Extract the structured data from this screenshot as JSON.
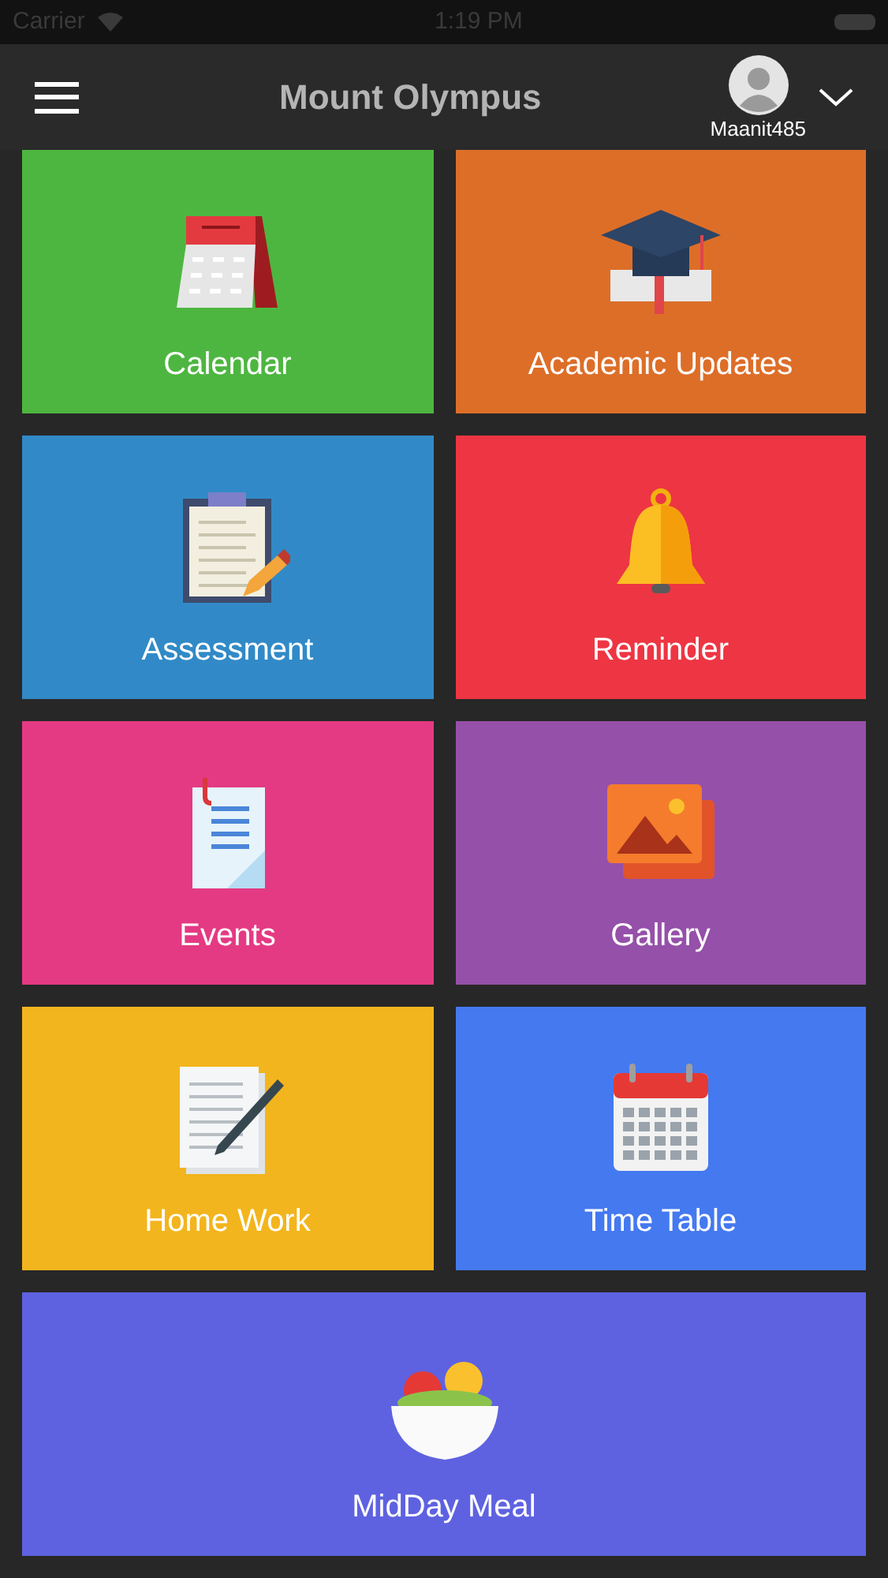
{
  "status_bar": {
    "carrier": "Carrier",
    "time": "1:19 PM"
  },
  "header": {
    "title": "Mount Olympus",
    "username": "Maanit485"
  },
  "tiles": [
    {
      "label": "Calendar",
      "color": "#4db640"
    },
    {
      "label": "Academic Updates",
      "color": "#dd6e28"
    },
    {
      "label": "Assessment",
      "color": "#318ac7"
    },
    {
      "label": "Reminder",
      "color": "#ee3543"
    },
    {
      "label": "Events",
      "color": "#e43a83"
    },
    {
      "label": "Gallery",
      "color": "#9550a9"
    },
    {
      "label": "Home Work",
      "color": "#f3b51d"
    },
    {
      "label": "Time Table",
      "color": "#4479f0"
    },
    {
      "label": "MidDay Meal",
      "color": "#5e62e0"
    }
  ]
}
